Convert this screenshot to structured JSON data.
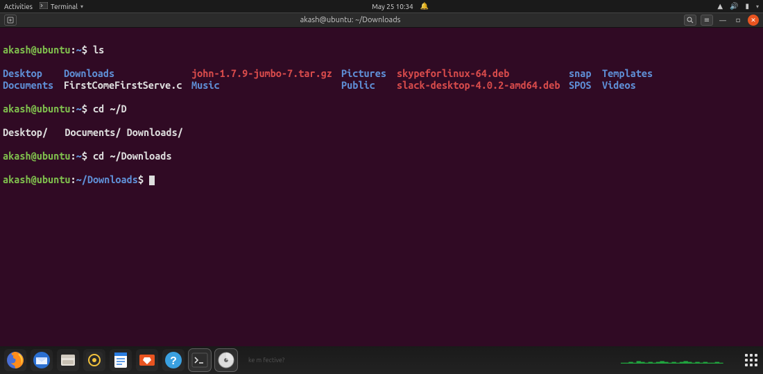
{
  "topbar": {
    "activities": "Activities",
    "app_name": "Terminal",
    "datetime": "May 25  10:34"
  },
  "window": {
    "title": "akash@ubuntu: ~/Downloads"
  },
  "terminal": {
    "user": "akash@ubuntu",
    "sep": ":",
    "home": "~",
    "dollar": "$",
    "downloads_path": "~/Downloads",
    "cmd_ls": "ls",
    "cmd_cd_tilde_D": "cd ~/D",
    "cmd_cd_downloads": "cd ~/Downloads",
    "ls_rows": [
      [
        {
          "t": "Desktop",
          "c": "dir"
        },
        {
          "t": "Downloads",
          "c": "dir"
        },
        {
          "t": "john-1.7.9-jumbo-7.tar.gz",
          "c": "archive"
        },
        {
          "t": "Pictures",
          "c": "dir"
        },
        {
          "t": "skypeforlinux-64.deb",
          "c": "archive"
        },
        {
          "t": "snap",
          "c": "dir"
        },
        {
          "t": "Templates",
          "c": "dir"
        }
      ],
      [
        {
          "t": "Documents",
          "c": "dir"
        },
        {
          "t": "FirstComeFirstServe.c",
          "c": "plain"
        },
        {
          "t": "Music",
          "c": "dir"
        },
        {
          "t": "Public",
          "c": "dir"
        },
        {
          "t": "slack-desktop-4.0.2-amd64.deb",
          "c": "archive"
        },
        {
          "t": "SPOS",
          "c": "dir"
        },
        {
          "t": "Videos",
          "c": "dir"
        }
      ]
    ],
    "tabcomp": "Desktop/   Documents/ Downloads/"
  },
  "dock": {
    "faint_question": "ke     m    fective?"
  }
}
